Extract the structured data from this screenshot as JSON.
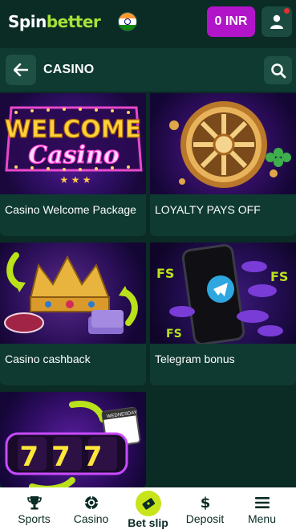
{
  "header": {
    "logo_part1": "Spin",
    "logo_part2": "better",
    "balance": "0 INR",
    "flag_icon": "india-flag-icon",
    "profile_icon": "user-icon"
  },
  "section": {
    "title": "CASINO",
    "back_icon": "arrow-left-icon",
    "search_icon": "search-icon"
  },
  "promotions": [
    {
      "title": "Casino Welcome Package",
      "art_text_line1": "WELCOME",
      "art_text_line2": "Casino"
    },
    {
      "title": "LOYALTY PAYS OFF"
    },
    {
      "title": "Casino cashback"
    },
    {
      "title": "Telegram bonus"
    },
    {
      "title": "",
      "art_text": "777",
      "art_badge": "WEDNESDAY"
    }
  ],
  "bottom_nav": [
    {
      "label": "Sports",
      "icon": "trophy-icon"
    },
    {
      "label": "Casino",
      "icon": "casino-chip-icon"
    },
    {
      "label": "Bet slip",
      "icon": "ticket-icon"
    },
    {
      "label": "Deposit",
      "icon": "dollar-icon"
    },
    {
      "label": "Menu",
      "icon": "hamburger-icon"
    }
  ],
  "colors": {
    "background": "#0b2b25",
    "accent_purple": "#b114c9",
    "accent_lime": "#c7e51a",
    "logo_green": "#a7e23a"
  }
}
